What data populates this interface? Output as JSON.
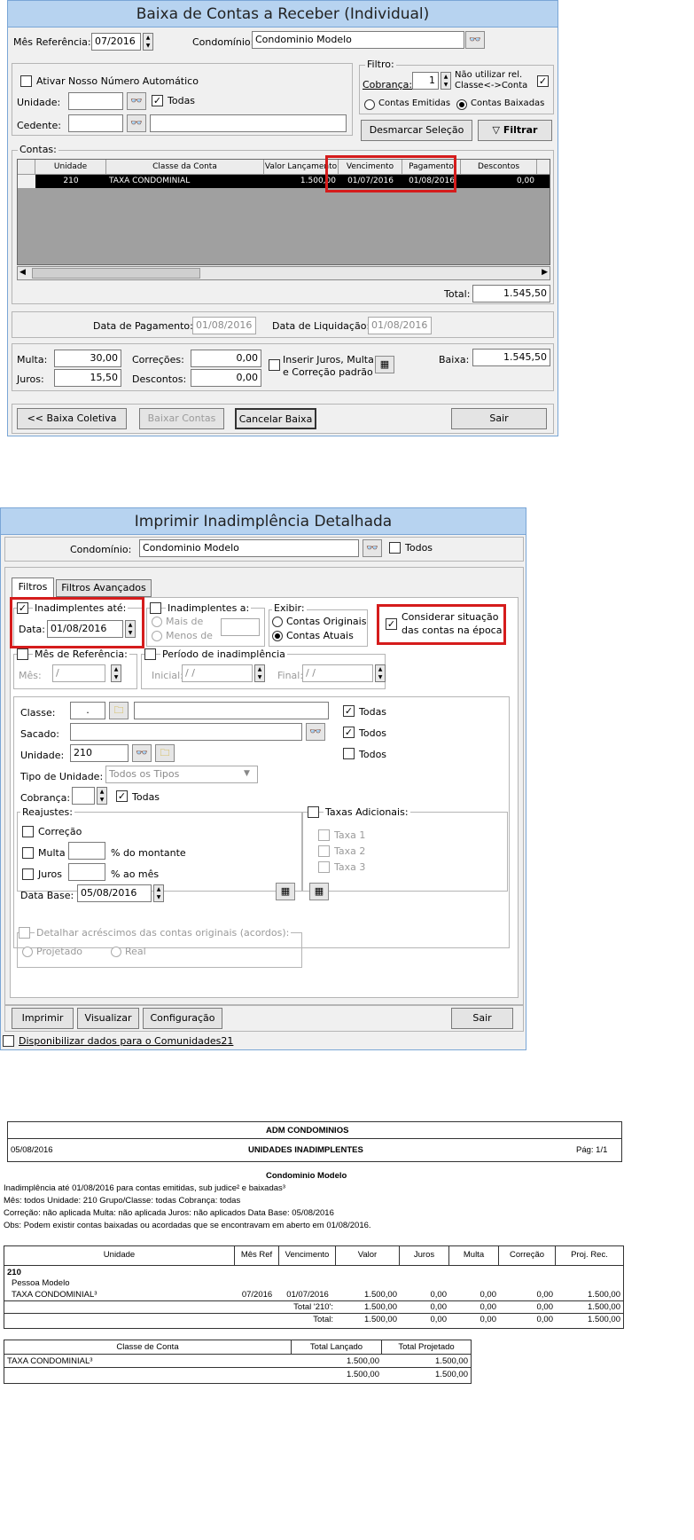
{
  "w1": {
    "title": "Baixa de Contas a Receber (Individual)",
    "mes_label": "Mês Referência:",
    "mes_value": "07/2016",
    "cond_label": "Condomínio:",
    "cond_value": "Condominio Modelo",
    "ativar_label": "Ativar Nosso Número Automático",
    "unidade_label": "Unidade:",
    "todas_label": "Todas",
    "cedente_label": "Cedente:",
    "filtro_title": "Filtro:",
    "cobranca_label": "Cobrança:",
    "cobranca_value": "1",
    "nao_utilizar_label": "Não utilizar rel. Classe<->Conta",
    "emitidas_label": "Contas Emitidas",
    "baixadas_label": "Contas Baixadas",
    "desmarcar_label": "Desmarcar Seleção",
    "filtrar_label": "Filtrar",
    "contas_title": "Contas:",
    "columns": [
      "Unidade",
      "Classe da Conta",
      "Valor Lançamento",
      "Vencimento",
      "Pagamento",
      "Descontos"
    ],
    "row": [
      "210",
      "TAXA CONDOMINIAL",
      "1.500,00",
      "01/07/2016",
      "01/08/2016",
      "0,00"
    ],
    "total_label": "Total:",
    "total_value": "1.545,50",
    "data_pag_label": "Data de Pagamento:",
    "data_pag_value": "01/08/2016",
    "data_liq_label": "Data de Liquidação:",
    "data_liq_value": "01/08/2016",
    "multa_label": "Multa:",
    "multa_value": "30,00",
    "juros_label": "Juros:",
    "juros_value": "15,50",
    "correcoes_label": "Correções:",
    "correcoes_value": "0,00",
    "descontos_label": "Descontos:",
    "descontos_value": "0,00",
    "inserir_label_1": "Inserir Juros, Multa",
    "inserir_label_2": "e Correção padrão",
    "baixa_label": "Baixa:",
    "baixa_value": "1.545,50",
    "btn_coletiva": "<< Baixa Coletiva",
    "btn_baixar": "Baixar Contas",
    "btn_cancelar": "Cancelar Baixa",
    "btn_sair": "Sair"
  },
  "w2": {
    "title": "Imprimir Inadimplência Detalhada",
    "cond_label": "Condomínio:",
    "cond_value": "Condominio Modelo",
    "todos_label": "Todos",
    "tab_filtros": "Filtros",
    "tab_avancados": "Filtros Avançados",
    "inad_ate_label": "Inadimplentes até:",
    "data_label": "Data:",
    "data_value": "01/08/2016",
    "inad_a_label": "Inadimplentes a:",
    "mais_de": "Mais de",
    "menos_de": "Menos de",
    "exibir_label": "Exibir:",
    "originais_label": "Contas Originais",
    "atuais_label": "Contas Atuais",
    "considerar_1": "Considerar situação",
    "considerar_2": "das contas na época",
    "mes_ref_label": "Mês de Referência:",
    "mes_label": "Mês:",
    "mes_value": "  /",
    "periodo_label": "Período de inadimplência",
    "inicial_label": "Inicial:",
    "inicial_value": " / /",
    "final_label": "Final:",
    "final_value": " / /",
    "classe_label": "Classe:",
    "classe_value": ".",
    "todas_label": "Todas",
    "sacado_label": "Sacado:",
    "todos_label2": "Todos",
    "unidade_label": "Unidade:",
    "unidade_value": "210",
    "todos_label3": "Todos",
    "tipo_label": "Tipo de Unidade:",
    "tipo_value": "Todos os Tipos",
    "cobranca_label": "Cobrança:",
    "todas_label2": "Todas",
    "reajustes_label": "Reajustes:",
    "correcao_label": "Correção",
    "multa_label": "Multa",
    "montante_label": "% do montante",
    "juros_label": "Juros",
    "ao_mes_label": "% ao mês",
    "data_base_label": "Data Base:",
    "data_base_value": "05/08/2016",
    "taxas_label": "Taxas Adicionais:",
    "taxa1": "Taxa 1",
    "taxa2": "Taxa 2",
    "taxa3": "Taxa 3",
    "detalhar_label": "Detalhar acréscimos das contas originais (acordos):",
    "projetado_label": "Projetado",
    "real_label": "Real",
    "btn_imprimir": "Imprimir",
    "btn_visualizar": "Visualizar",
    "btn_config": "Configuração",
    "btn_sair": "Sair",
    "disponibilizar_label": "Disponibilizar dados para o Comunidades21"
  },
  "report": {
    "company": "ADM CONDOMINIOS",
    "date": "05/08/2016",
    "title": "UNIDADES INADIMPLENTES",
    "page": "Pág: 1/1",
    "cond": "Condominio Modelo",
    "line1": "Inadimplência até 01/08/2016 para contas emitidas, sub judice² e baixadas³",
    "line2": "Mês: todos   Unidade: 210   Grupo/Classe: todas   Cobrança: todas",
    "line3": "Correção: não aplicada    Multa: não aplicada    Juros: não aplicados    Data Base: 05/08/2016",
    "line4": "Obs: Podem existir contas baixadas ou acordadas que se encontravam em aberto em 01/08/2016.",
    "headers": [
      "Unidade",
      "Mês Ref",
      "Vencimento",
      "Valor",
      "Juros",
      "Multa",
      "Correção",
      "Proj. Rec."
    ],
    "unit": "210",
    "person": "Pessoa Modelo",
    "item": "TAXA CONDOMINIAL³",
    "row": [
      "07/2016",
      "01/07/2016",
      "1.500,00",
      "0,00",
      "0,00",
      "0,00",
      "1.500,00"
    ],
    "total_unit_label": "Total '210':",
    "total_unit": [
      "1.500,00",
      "0,00",
      "0,00",
      "0,00",
      "1.500,00"
    ],
    "total_label": "Total:",
    "total": [
      "1.500,00",
      "0,00",
      "0,00",
      "0,00",
      "1.500,00"
    ],
    "t2_headers": [
      "Classe de Conta",
      "Total Lançado",
      "Total Projetado"
    ],
    "t2_row": [
      "TAXA CONDOMINIAL³",
      "1.500,00",
      "1.500,00"
    ],
    "t2_total": [
      "1.500,00",
      "1.500,00"
    ]
  }
}
